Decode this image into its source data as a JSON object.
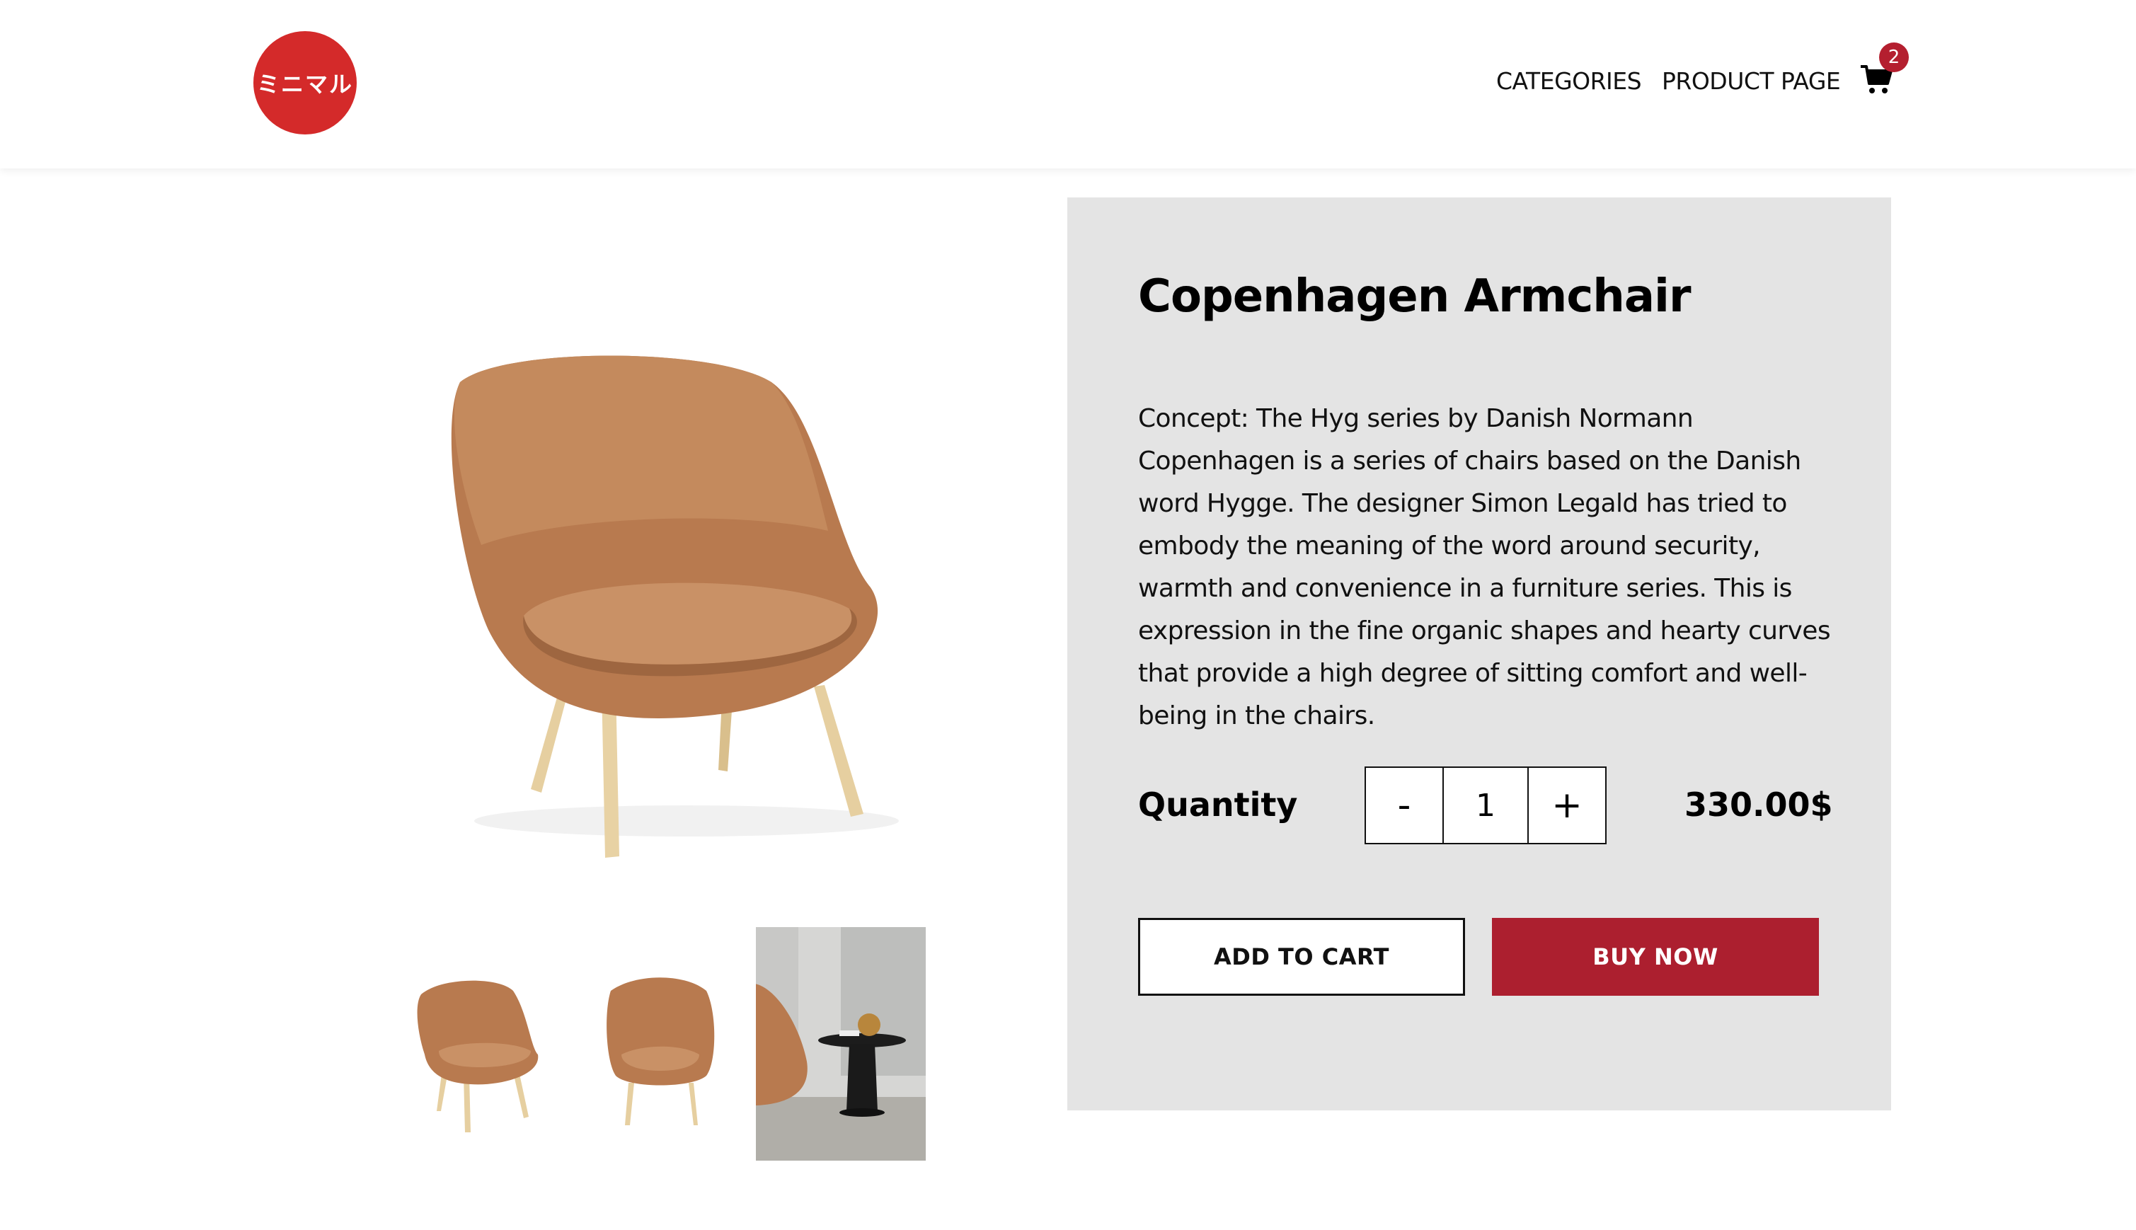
{
  "header": {
    "logo_text": "ミニマル",
    "nav": {
      "categories": "CATEGORIES",
      "product_page": "PRODUCT PAGE"
    },
    "cart_count": "2",
    "cart_icon": "shopping-cart-icon"
  },
  "product": {
    "title": "Copenhagen Armchair",
    "description": "Concept: The Hyg series by Danish Normann Copenhagen is a series of chairs based on the Danish word Hygge. The designer Simon Legald has tried to embody the meaning of the word around security, warmth and convenience in a furniture series. This is expression in the fine organic shapes and hearty curves that provide a high degree of sitting comfort and well-being in the chairs.",
    "quantity_label": "Quantity",
    "quantity_minus": "-",
    "quantity_value": "1",
    "quantity_plus": "+",
    "price": "330.00$",
    "add_to_cart": "ADD TO CART",
    "buy_now": "BUY NOW"
  },
  "colors": {
    "logo": "#d42a2a",
    "accent": "#ac1f2f",
    "panel": "#e4e4e4",
    "leather": "#b87a4f",
    "wood": "#e6cfa0"
  }
}
